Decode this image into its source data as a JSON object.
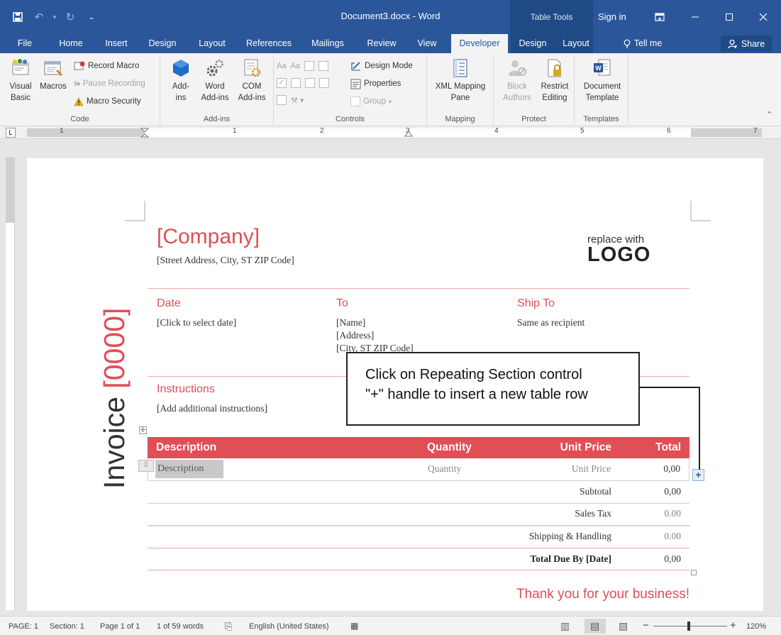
{
  "window": {
    "doc_title": "Document3.docx - Word",
    "context_title": "Table Tools",
    "sign_in": "Sign in"
  },
  "tabs": [
    {
      "label": "File"
    },
    {
      "label": "Home"
    },
    {
      "label": "Insert"
    },
    {
      "label": "Design"
    },
    {
      "label": "Layout"
    },
    {
      "label": "References"
    },
    {
      "label": "Mailings"
    },
    {
      "label": "Review"
    },
    {
      "label": "View"
    },
    {
      "label": "Developer",
      "active": true
    },
    {
      "label": "Design"
    },
    {
      "label": "Layout"
    }
  ],
  "tell_me": "Tell me",
  "share": "Share",
  "ribbon": {
    "code": {
      "label": "Code",
      "visual_basic": "Visual Basic",
      "macros": "Macros",
      "record_macro": "Record Macro",
      "pause_recording": "Pause Recording",
      "macro_security": "Macro Security"
    },
    "addins": {
      "label": "Add-ins",
      "addins_btn": "Add-ins",
      "word_addins": "Word Add-ins",
      "com_addins": "COM Add-ins"
    },
    "controls": {
      "label": "Controls",
      "design_mode": "Design Mode",
      "properties": "Properties",
      "group": "Group"
    },
    "mapping": {
      "label": "Mapping",
      "xml_mapping_pane": "XML Mapping Pane"
    },
    "protect": {
      "label": "Protect",
      "block_authors": "Block Authors",
      "restrict_editing": "Restrict Editing"
    },
    "templates": {
      "label": "Templates",
      "document_template": "Document Template"
    }
  },
  "ruler": {
    "numbers": [
      "1",
      "1",
      "2",
      "3",
      "4",
      "5",
      "6",
      "7"
    ]
  },
  "invoice": {
    "side_title": "Invoice [0000]",
    "company": "[Company]",
    "address": "[Street Address, City, ST ZIP Code]",
    "logo_small": "replace with",
    "logo_big": "LOGO",
    "date_label": "Date",
    "date_value": "[Click to select date]",
    "to_label": "To",
    "to_name": "[Name]",
    "to_address": "[Address]",
    "to_city": "[City, ST  ZIP Code]",
    "shipto_label": "Ship To",
    "shipto_value": "Same as recipient",
    "instructions_label": "Instructions",
    "instructions_value": "[Add additional instructions]",
    "table_headers": [
      "Description",
      "Quantity",
      "Unit Price",
      "Total"
    ],
    "row": [
      "Description",
      "Quantity",
      "Unit Price",
      "0,00"
    ],
    "subtotal_label": "Subtotal",
    "subtotal_value": "0,00",
    "salestax_label": "Sales Tax",
    "salestax_value": "0.00",
    "shipping_label": "Shipping & Handling",
    "shipping_value": "0.00",
    "totaldue_label": "Total Due By [Date]",
    "totaldue_value": "0,00",
    "thanks": "Thank you for your business!"
  },
  "callout": {
    "line1": "Click on Repeating Section control",
    "line2": "\"+\" handle to insert a new table row"
  },
  "status": {
    "page": "PAGE: 1",
    "section": "Section: 1",
    "page_of": "Page 1 of 1",
    "words": "1 of 59 words",
    "language": "English (United States)",
    "zoom": "120%"
  },
  "colors": {
    "accent": "#e04e56",
    "titlebar": "#2b579a"
  }
}
